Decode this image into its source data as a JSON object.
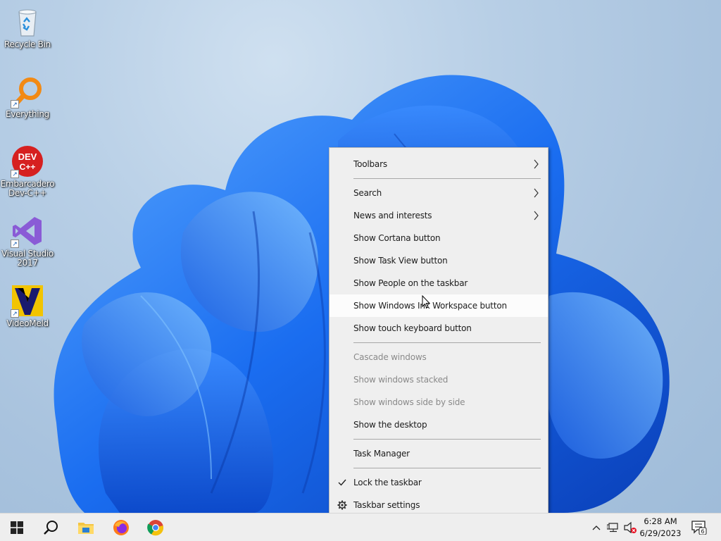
{
  "desktop": {
    "icons": [
      {
        "label": "Recycle Bin",
        "icon": "recycle-bin-icon"
      },
      {
        "label": "Everything",
        "icon": "everything-search-icon"
      },
      {
        "label": "Embarcadero Dev-C++",
        "icon": "devcpp-icon",
        "badge_text": "DEV C++"
      },
      {
        "label": "Visual Studio 2017",
        "icon": "visual-studio-icon"
      },
      {
        "label": "VideoMeld",
        "icon": "videomeld-icon"
      }
    ]
  },
  "context_menu": {
    "items": {
      "toolbars": "Toolbars",
      "search": "Search",
      "news": "News and interests",
      "cortana": "Show Cortana button",
      "task_view": "Show Task View button",
      "people": "Show People on the taskbar",
      "ink": "Show Windows Ink Workspace button",
      "touch_keyboard": "Show touch keyboard button",
      "cascade": "Cascade windows",
      "stacked": "Show windows stacked",
      "side_by_side": "Show windows side by side",
      "show_desktop": "Show the desktop",
      "task_manager": "Task Manager",
      "lock_taskbar": "Lock the taskbar",
      "taskbar_settings": "Taskbar settings"
    },
    "checked": [
      "lock_taskbar"
    ],
    "disabled": [
      "cascade",
      "stacked",
      "side_by_side"
    ],
    "hovered": "ink"
  },
  "taskbar": {
    "pinned": [
      "start-button",
      "search-button",
      "file-explorer",
      "firefox",
      "chrome"
    ],
    "clock": {
      "time": "6:28 AM",
      "date": "6/29/2023"
    },
    "notifications_count": "6"
  },
  "colors": {
    "accent": "#0f6bdc",
    "taskbar": "#eeeeee",
    "menu": "#efefef"
  }
}
